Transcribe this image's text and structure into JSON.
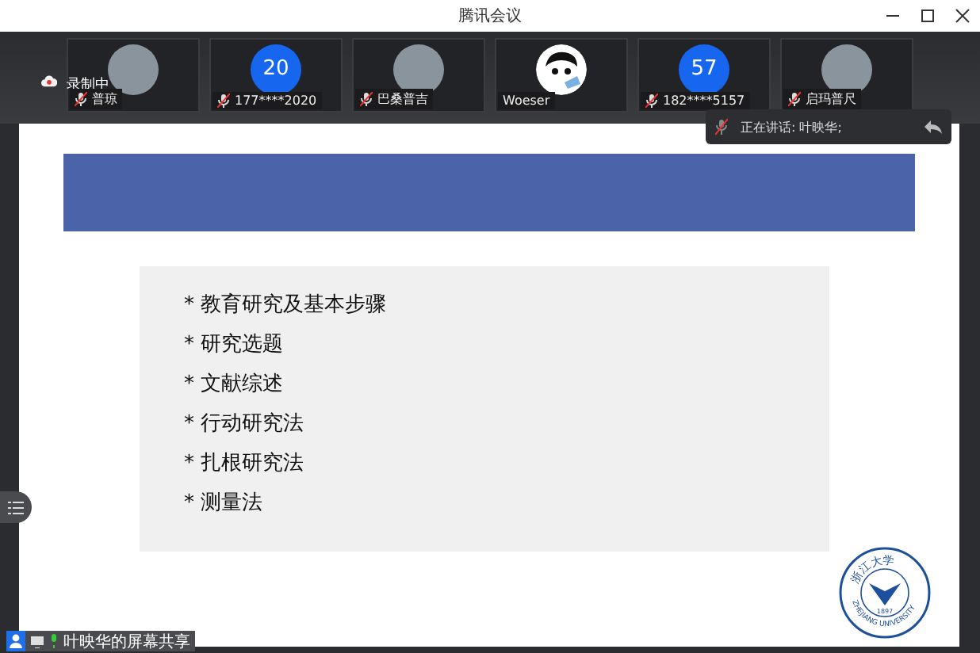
{
  "window": {
    "title": "腾讯会议"
  },
  "recording": {
    "label": "录制中"
  },
  "participants": [
    {
      "name": "普琼",
      "kind": "photo",
      "muted": true
    },
    {
      "name": "177****2020",
      "kind": "number",
      "avatar_text": "20",
      "muted": true
    },
    {
      "name": "巴桑普吉",
      "kind": "photo",
      "muted": true
    },
    {
      "name": "Woeser",
      "kind": "cartoon",
      "muted": false
    },
    {
      "name": "182****5157",
      "kind": "number",
      "avatar_text": "57",
      "muted": true
    },
    {
      "name": "启玛普尺",
      "kind": "photo",
      "muted": true
    }
  ],
  "speaking": {
    "label": "正在讲话: 叶映华;"
  },
  "slide": {
    "bullets": [
      "* 教育研究及基本步骤",
      "* 研究选题",
      "* 文献综述",
      "* 行动研究法",
      "* 扎根研究法",
      "* 测量法"
    ],
    "logo": {
      "top_text": "浙江大学",
      "year": "1897",
      "bottom_text": "ZHEJIANG UNIVERSITY"
    }
  },
  "share_label": "叶映华的屏幕共享"
}
